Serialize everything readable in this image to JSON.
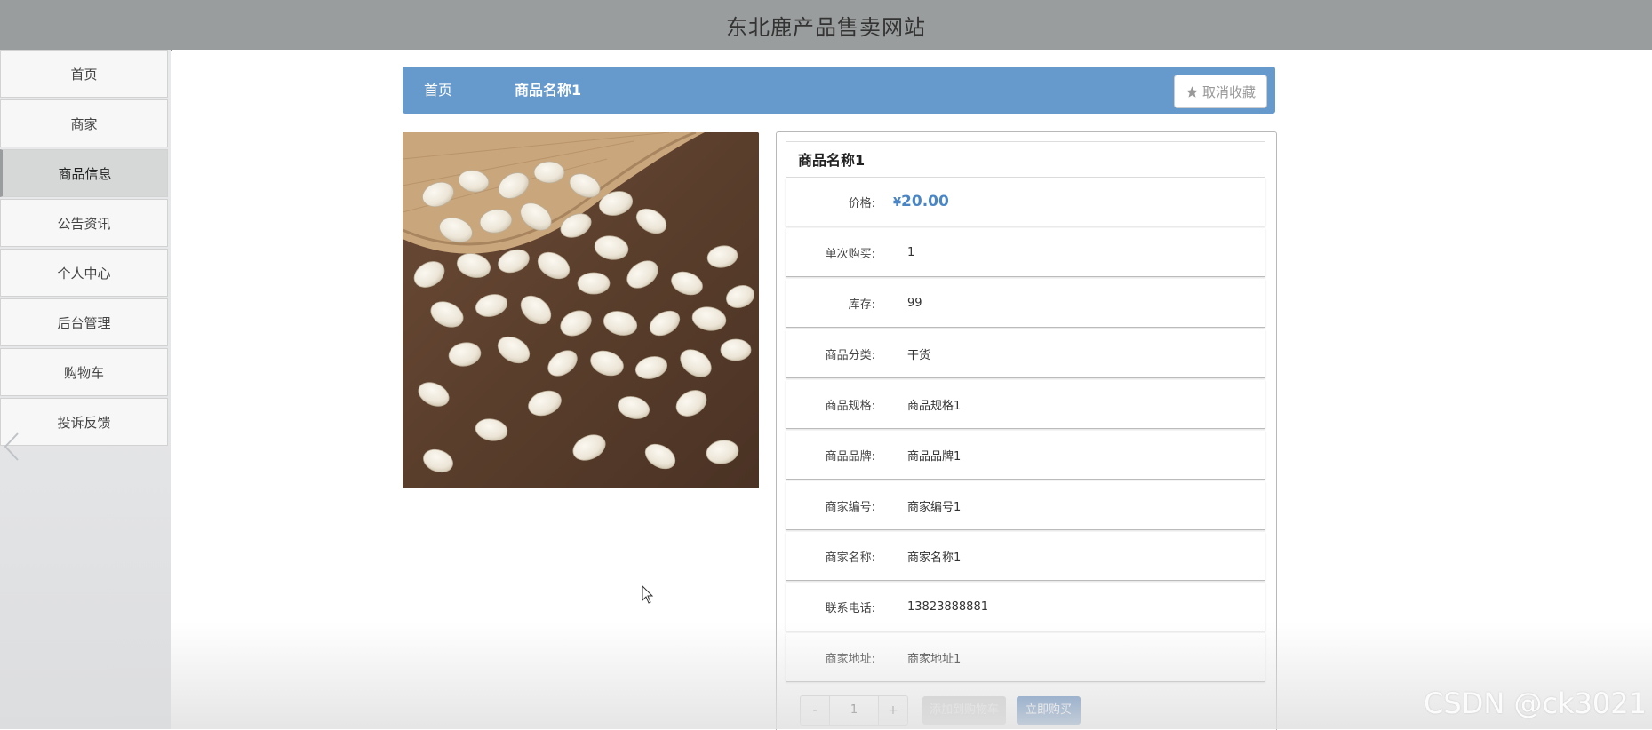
{
  "site": {
    "title": "东北鹿产品售卖网站"
  },
  "sidebar": {
    "items": [
      {
        "label": "首页"
      },
      {
        "label": "商家"
      },
      {
        "label": "商品信息",
        "active": true
      },
      {
        "label": "公告资讯"
      },
      {
        "label": "个人中心"
      },
      {
        "label": "后台管理"
      },
      {
        "label": "购物车"
      },
      {
        "label": "投诉反馈"
      }
    ]
  },
  "breadcrumb": {
    "home": "首页",
    "current": "商品名称1"
  },
  "favorite": {
    "label": "取消收藏",
    "icon": "star-icon"
  },
  "product": {
    "name": "商品名称1",
    "price_symbol": "¥",
    "price": "20.00",
    "fields": [
      {
        "label": "单次购买:",
        "value": "1"
      },
      {
        "label": "库存:",
        "value": "99"
      },
      {
        "label": "商品分类:",
        "value": "干货"
      },
      {
        "label": "商品规格:",
        "value": "商品规格1"
      },
      {
        "label": "商品品牌:",
        "value": "商品品牌1"
      },
      {
        "label": "商家编号:",
        "value": "商家编号1"
      },
      {
        "label": "商家名称:",
        "value": "商家名称1"
      },
      {
        "label": "联系电话:",
        "value": "13823888881"
      },
      {
        "label": "商家地址:",
        "value": "商家地址1"
      }
    ],
    "price_label": "价格:"
  },
  "purchase": {
    "minus": "-",
    "quantity": "1",
    "plus": "+",
    "add_to_cart": "添加到购物车",
    "buy_now": "立即购买"
  },
  "watermark": "CSDN @ck3021",
  "colors": {
    "accent": "#6699cc",
    "price": "#4a86c5",
    "topbar": "#9a9d9e",
    "buy": "#3a6fb0"
  }
}
